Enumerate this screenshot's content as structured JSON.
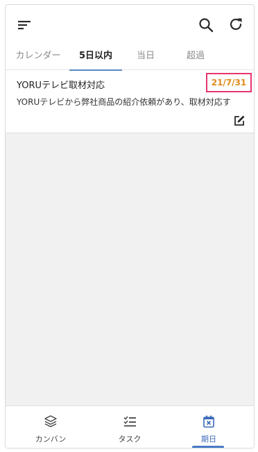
{
  "toolbar": {
    "menu_icon": "sort-menu-icon",
    "search_icon": "search-icon",
    "refresh_icon": "refresh-icon"
  },
  "tabs": [
    {
      "label": "カレンダー",
      "active": false
    },
    {
      "label": "5日以内",
      "active": true
    },
    {
      "label": "当日",
      "active": false
    },
    {
      "label": "超過",
      "active": false
    }
  ],
  "tasks": [
    {
      "title": "YORUテレビ取材対応",
      "due_date": "21/7/31",
      "description": "YORUテレビから弊社商品の紹介依頼があり、取材対応す",
      "edit_icon": "edit-icon"
    }
  ],
  "bottom_nav": [
    {
      "label": "カンバン",
      "icon": "layers-icon",
      "active": false
    },
    {
      "label": "タスク",
      "icon": "checklist-icon",
      "active": false
    },
    {
      "label": "期日",
      "icon": "calendar-x-icon",
      "active": true
    }
  ],
  "colors": {
    "accent": "#4a7bc7",
    "due_date": "#e08a1a",
    "highlight_border": "#e5356d",
    "background": "#f1f1f1"
  }
}
